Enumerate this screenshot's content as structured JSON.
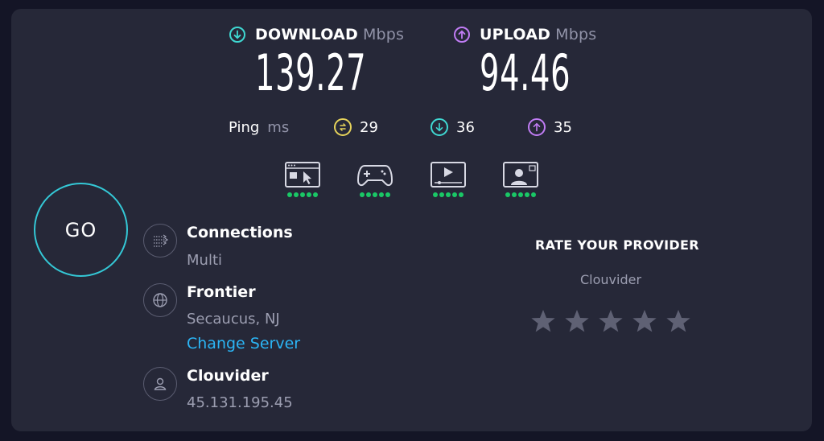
{
  "download": {
    "label": "DOWNLOAD",
    "unit": "Mbps",
    "value": "139.27",
    "icon": "arrow-down-circle-icon",
    "color": "#3fd8d2"
  },
  "upload": {
    "label": "UPLOAD",
    "unit": "Mbps",
    "value": "94.46",
    "icon": "arrow-up-circle-icon",
    "color": "#c07cf4"
  },
  "ping": {
    "label": "Ping",
    "unit": "ms",
    "idle": {
      "value": "29",
      "icon": "ping-idle-icon",
      "color": "#e6d35b"
    },
    "download": {
      "value": "36",
      "icon": "ping-download-icon",
      "color": "#3fd8d2"
    },
    "upload": {
      "value": "35",
      "icon": "ping-upload-icon",
      "color": "#c07cf4"
    }
  },
  "activities": [
    {
      "name": "web-browsing-icon",
      "rating": 5
    },
    {
      "name": "gaming-icon",
      "rating": 5
    },
    {
      "name": "streaming-icon",
      "rating": 5
    },
    {
      "name": "video-call-icon",
      "rating": 5
    }
  ],
  "go_button": "GO",
  "connections": {
    "title": "Connections",
    "value": "Multi"
  },
  "server": {
    "title": "Frontier",
    "location": "Secaucus, NJ",
    "change_link": "Change Server"
  },
  "provider": {
    "title": "Clouvider",
    "ip": "45.131.195.45"
  },
  "rating": {
    "title": "RATE YOUR PROVIDER",
    "provider_name": "Clouvider",
    "stars": 5,
    "star_color": "#5f6174"
  },
  "colors": {
    "background": "#141526",
    "panel": "#262838",
    "accent_go": "#34c8d6",
    "link": "#2bb5f5",
    "green": "#1ac866"
  }
}
